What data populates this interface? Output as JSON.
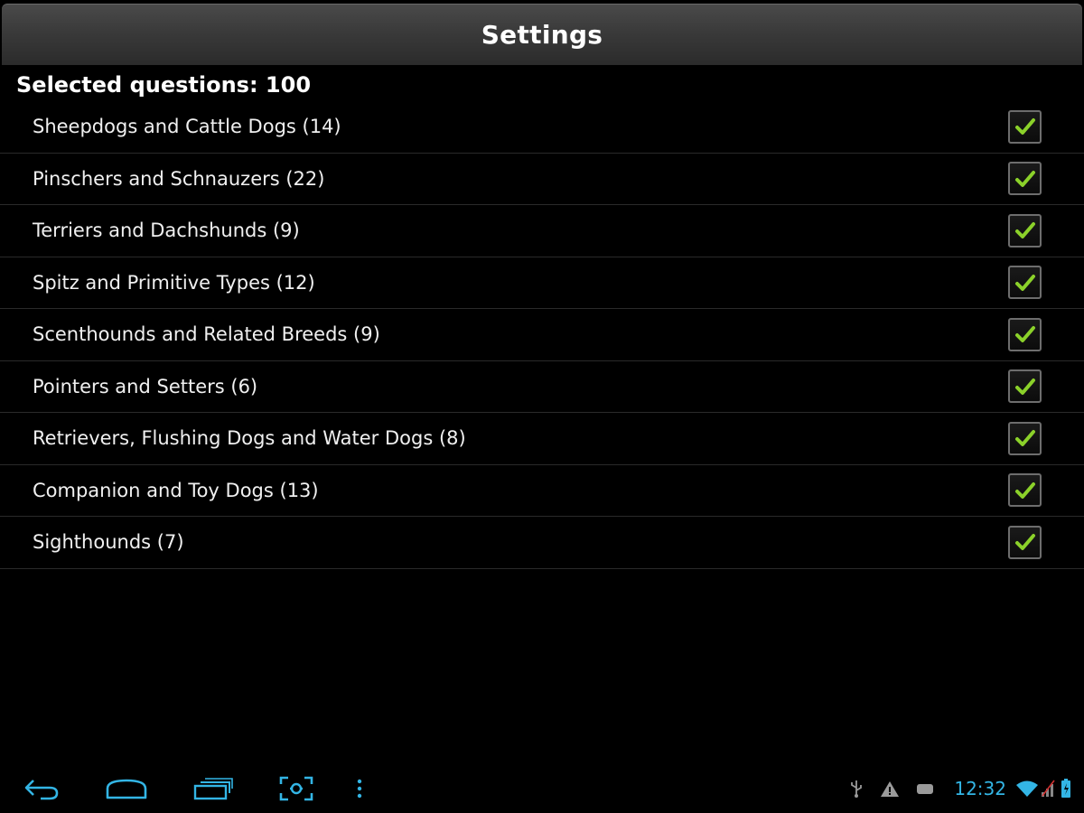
{
  "header": {
    "title": "Settings"
  },
  "summary": {
    "selected_label": "Selected questions: 100"
  },
  "categories": [
    {
      "label": "Sheepdogs and Cattle Dogs (14)",
      "checked": true
    },
    {
      "label": "Pinschers and Schnauzers (22)",
      "checked": true
    },
    {
      "label": "Terriers and Dachshunds (9)",
      "checked": true
    },
    {
      "label": "Spitz and Primitive Types (12)",
      "checked": true
    },
    {
      "label": "Scenthounds and Related Breeds (9)",
      "checked": true
    },
    {
      "label": "Pointers and Setters (6)",
      "checked": true
    },
    {
      "label": "Retrievers, Flushing Dogs and Water Dogs (8)",
      "checked": true
    },
    {
      "label": "Companion and Toy Dogs (13)",
      "checked": true
    },
    {
      "label": "Sighthounds (7)",
      "checked": true
    }
  ],
  "system_bar": {
    "clock": "12:32",
    "nav_icons": [
      "back-icon",
      "home-icon",
      "recent-apps-icon",
      "screenshot-icon",
      "menu-icon"
    ],
    "status_icons": [
      "usb-icon",
      "warning-icon",
      "notification-icon",
      "wifi-icon",
      "signal-icon",
      "battery-icon"
    ]
  },
  "colors": {
    "background": "#000000",
    "check": "#8bd12a",
    "accent": "#33b5e5",
    "titlebar": "#3a3a3a"
  }
}
